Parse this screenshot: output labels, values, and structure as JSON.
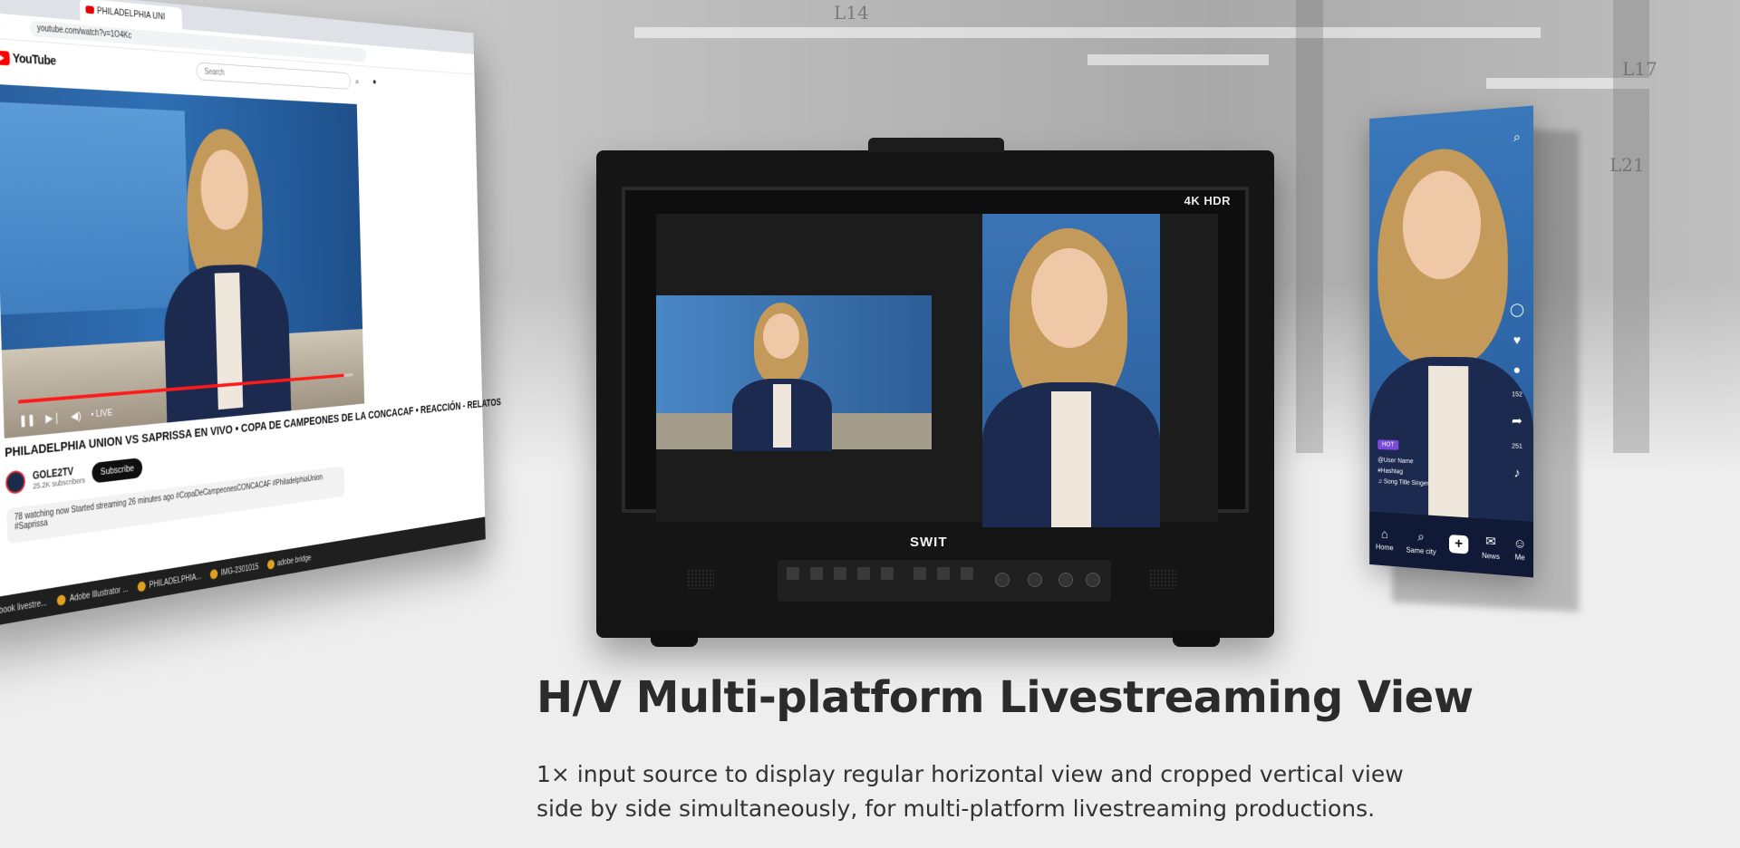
{
  "browser": {
    "tab_title": "PHILADELPHIA UNI",
    "url": "youtube.com/watch?v=1O4Kc",
    "search_placeholder": "Search",
    "logo_text": "YouTube"
  },
  "video": {
    "live_label": "• LIVE",
    "title": "PHILADELPHIA UNION VS SAPRISSA EN VIVO • COPA DE CAMPEONES DE LA CONCACAF • REACCIÓN - RELATOS",
    "channel": "GOLE2TV",
    "subscribers": "25.2K subscribers",
    "subscribe_label": "Subscribe",
    "description": "78 watching now  Started streaming 26 minutes ago #CopaDeCampeonesCONCACAF #PhiladelphiaUnion #Saprissa",
    "progress_percent": 97
  },
  "taskbar": {
    "items": [
      "facebook livestre...",
      "Adobe Illustrator ...",
      "PHILADELPHIA...",
      "IMG-2301015",
      "adobe bridge"
    ]
  },
  "monitor": {
    "hdr_label": "4K HDR",
    "brand": "SWIT"
  },
  "phone": {
    "hot_tag": "HOT",
    "meta_lines": [
      "@User Name",
      "#Hashtag",
      "♫ Song Title Singer"
    ],
    "side_counts": [
      "152",
      "251"
    ],
    "nav": [
      {
        "label": "Home",
        "icon": "home-icon"
      },
      {
        "label": "Same city",
        "icon": "search-icon"
      },
      {
        "label": "",
        "icon": "plus-icon"
      },
      {
        "label": "News",
        "icon": "chat-icon"
      },
      {
        "label": "Me",
        "icon": "user-icon"
      }
    ]
  },
  "content": {
    "headline": "H/V Multi-platform Livestreaming View",
    "description_line1": "1× input source to display regular horizontal view and cropped vertical view",
    "description_line2": "side by side simultaneously, for multi-platform livestreaming productions."
  },
  "colors": {
    "youtube_red": "#ff0000",
    "background": "#eeeeee",
    "headline": "#2b2b2b"
  }
}
